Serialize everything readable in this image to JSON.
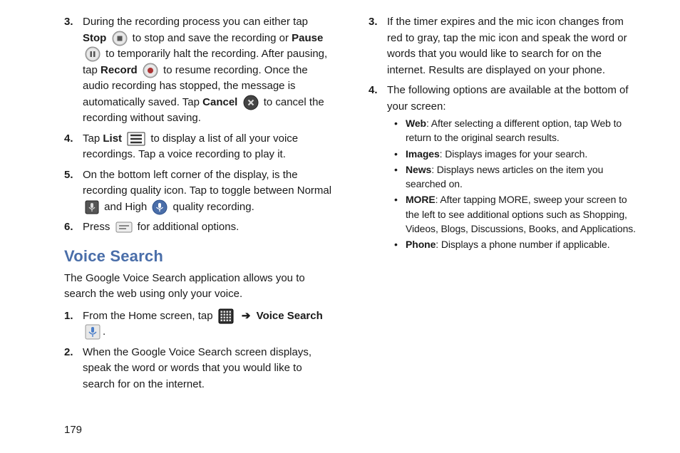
{
  "page_number": "179",
  "left": {
    "items": [
      {
        "num": "3.",
        "parts": [
          {
            "t": "During the recording process you can either tap "
          },
          {
            "bold": "Stop"
          },
          {
            "t": " "
          },
          {
            "icon": "stop-icon"
          },
          {
            "t": " to stop and save the recording or "
          },
          {
            "bold": "Pause"
          },
          {
            "t": " "
          },
          {
            "icon": "pause-icon"
          },
          {
            "t": " to temporarily halt the recording. After pausing, tap "
          },
          {
            "bold": "Record"
          },
          {
            "t": " "
          },
          {
            "icon": "record-icon"
          },
          {
            "t": " to resume recording. Once the audio recording has stopped, the message is automatically saved. Tap "
          },
          {
            "bold": "Cancel"
          },
          {
            "t": " "
          },
          {
            "icon": "cancel-icon"
          },
          {
            "t": " to cancel the recording without saving."
          }
        ]
      },
      {
        "num": "4.",
        "parts": [
          {
            "t": "Tap "
          },
          {
            "bold": "List"
          },
          {
            "t": " "
          },
          {
            "icon": "list-icon"
          },
          {
            "t": " to display a list of all your voice recordings. Tap a voice recording to play it."
          }
        ]
      },
      {
        "num": "5.",
        "parts": [
          {
            "t": "On the bottom left corner of the display, is the recording quality icon. Tap to toggle between Normal "
          },
          {
            "icon": "mic-normal-icon"
          },
          {
            "t": " and High "
          },
          {
            "icon": "mic-high-icon"
          },
          {
            "t": " quality recording."
          }
        ]
      },
      {
        "num": "6.",
        "parts": [
          {
            "t": "Press "
          },
          {
            "icon": "menu-icon"
          },
          {
            "t": " for additional options."
          }
        ]
      }
    ],
    "heading": "Voice Search",
    "lead": "The Google Voice Search application allows you to search the web using only your voice.",
    "items2": [
      {
        "num": "1.",
        "parts": [
          {
            "t": "From the Home screen, tap "
          },
          {
            "icon": "apps-icon"
          },
          {
            "t": " "
          },
          {
            "arrow": "➔"
          },
          {
            "t": " "
          },
          {
            "bold": "Voice Search"
          },
          {
            "t": " "
          },
          {
            "icon": "voice-search-icon"
          },
          {
            "t": "."
          }
        ]
      },
      {
        "num": "2.",
        "parts": [
          {
            "t": " When the Google Voice Search screen displays, speak the word or words that you would like to search for on the internet."
          }
        ]
      }
    ]
  },
  "right": {
    "items": [
      {
        "num": "3.",
        "parts": [
          {
            "t": "If the timer expires and the mic icon changes from red to gray, tap the mic icon and speak the word or words that you would like to search for on the internet.  Results are displayed on your phone."
          }
        ]
      },
      {
        "num": "4.",
        "parts": [
          {
            "t": "The following options are available at the bottom of your screen:"
          }
        ],
        "bullets": [
          {
            "label": "Web",
            "text": ": After selecting a different option, tap Web to return to the original search results."
          },
          {
            "label": "Images",
            "text": ": Displays images for your search."
          },
          {
            "label": "News",
            "text": ": Displays news articles on the item you searched on."
          },
          {
            "label": "MORE",
            "text": ": After tapping MORE, sweep your screen to the left to see additional options such as Shopping, Videos, Blogs, Discussions, Books, and Applications."
          },
          {
            "label": "Phone",
            "text": ": Displays a phone number if applicable."
          }
        ]
      }
    ]
  }
}
